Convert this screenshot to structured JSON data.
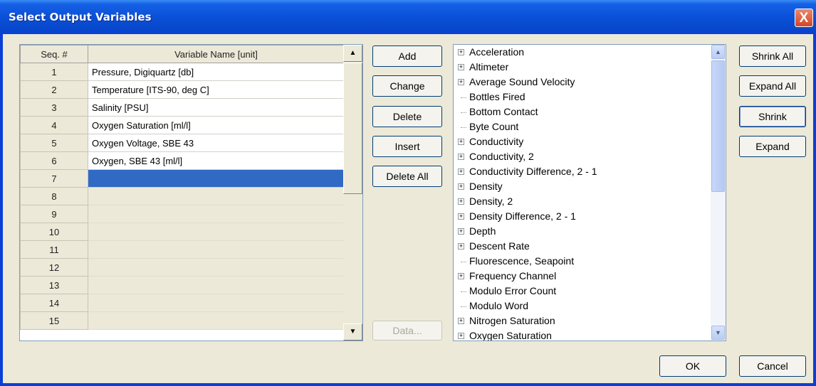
{
  "window": {
    "title": "Select Output Variables",
    "close_glyph": "X"
  },
  "grid": {
    "headers": [
      "Seq. #",
      "Variable Name [unit]"
    ],
    "rows": [
      {
        "seq": "1",
        "name": "Pressure, Digiquartz [db]"
      },
      {
        "seq": "2",
        "name": "Temperature [ITS-90, deg C]"
      },
      {
        "seq": "3",
        "name": "Salinity [PSU]"
      },
      {
        "seq": "4",
        "name": "Oxygen Saturation [ml/l]"
      },
      {
        "seq": "5",
        "name": "Oxygen Voltage, SBE 43"
      },
      {
        "seq": "6",
        "name": "Oxygen, SBE 43 [ml/l]"
      },
      {
        "seq": "7",
        "name": ""
      },
      {
        "seq": "8",
        "name": ""
      },
      {
        "seq": "9",
        "name": ""
      },
      {
        "seq": "10",
        "name": ""
      },
      {
        "seq": "11",
        "name": ""
      },
      {
        "seq": "12",
        "name": ""
      },
      {
        "seq": "13",
        "name": ""
      },
      {
        "seq": "14",
        "name": ""
      },
      {
        "seq": "15",
        "name": ""
      }
    ],
    "selected_row": 7
  },
  "actions": {
    "add": "Add",
    "change": "Change",
    "delete": "Delete",
    "insert": "Insert",
    "delete_all": "Delete All",
    "data": "Data..."
  },
  "tree": {
    "items": [
      {
        "label": "Acceleration",
        "expandable": true
      },
      {
        "label": "Altimeter",
        "expandable": true
      },
      {
        "label": "Average Sound Velocity",
        "expandable": true
      },
      {
        "label": "Bottles Fired",
        "expandable": false
      },
      {
        "label": "Bottom Contact",
        "expandable": false
      },
      {
        "label": "Byte Count",
        "expandable": false
      },
      {
        "label": "Conductivity",
        "expandable": true
      },
      {
        "label": "Conductivity, 2",
        "expandable": true
      },
      {
        "label": "Conductivity Difference, 2 - 1",
        "expandable": true
      },
      {
        "label": "Density",
        "expandable": true
      },
      {
        "label": "Density, 2",
        "expandable": true
      },
      {
        "label": "Density Difference, 2 - 1",
        "expandable": true
      },
      {
        "label": "Depth",
        "expandable": true
      },
      {
        "label": "Descent Rate",
        "expandable": true
      },
      {
        "label": "Fluorescence, Seapoint",
        "expandable": false
      },
      {
        "label": "Frequency Channel",
        "expandable": true
      },
      {
        "label": "Modulo Error Count",
        "expandable": false
      },
      {
        "label": "Modulo Word",
        "expandable": false
      },
      {
        "label": "Nitrogen Saturation",
        "expandable": true
      },
      {
        "label": "Oxygen Saturation",
        "expandable": true
      }
    ]
  },
  "tree_actions": {
    "shrink_all": "Shrink All",
    "expand_all": "Expand All",
    "shrink": "Shrink",
    "expand": "Expand"
  },
  "footer": {
    "ok": "OK",
    "cancel": "Cancel"
  }
}
